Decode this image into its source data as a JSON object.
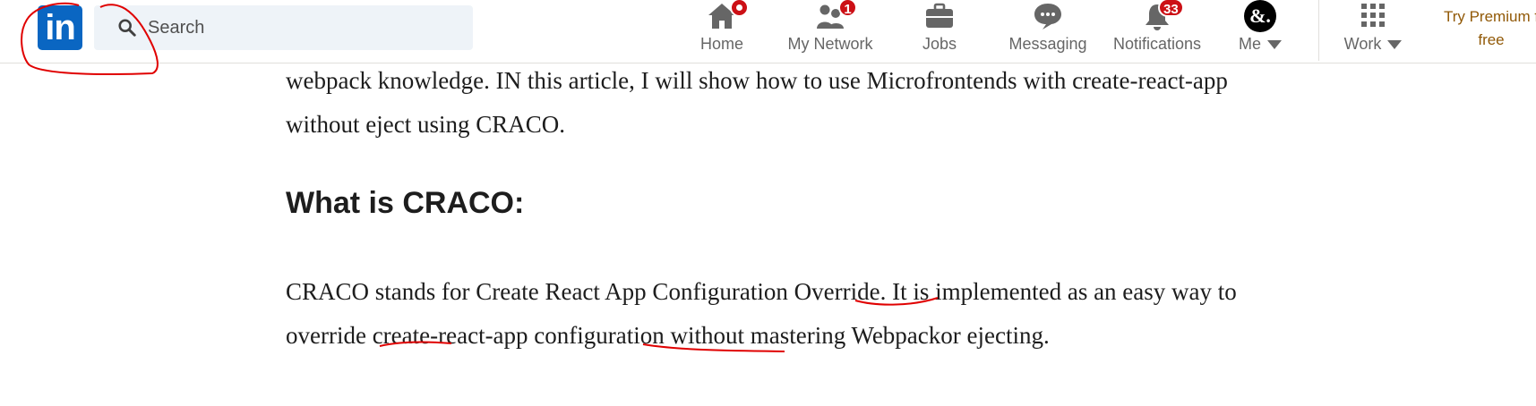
{
  "nav": {
    "logo_text": "in",
    "search": {
      "placeholder": "Search",
      "value": ""
    },
    "items": [
      {
        "id": "home",
        "label": "Home",
        "icon": "home-icon",
        "badge": ""
      },
      {
        "id": "network",
        "label": "My Network",
        "icon": "people-icon",
        "badge": "1"
      },
      {
        "id": "jobs",
        "label": "Jobs",
        "icon": "briefcase-icon",
        "badge": ""
      },
      {
        "id": "messaging",
        "label": "Messaging",
        "icon": "chat-icon",
        "badge": ""
      },
      {
        "id": "notifications",
        "label": "Notifications",
        "icon": "bell-icon",
        "badge": "33"
      },
      {
        "id": "me",
        "label": "Me",
        "icon": "avatar-icon",
        "badge": ""
      },
      {
        "id": "work",
        "label": "Work",
        "icon": "grid-icon",
        "badge": ""
      }
    ],
    "avatar_text": "&.",
    "premium": {
      "line1": "Try Premium f",
      "line2": "free"
    }
  },
  "article": {
    "intro": "webpack knowledge. IN this article, I will show how to use Microfrontends with create-react-app without eject using CRACO.",
    "heading": "What is CRACO:",
    "body": {
      "t1": "CRACO stands for Create React App Configuration ",
      "w1": "Override",
      "t2": ". It is implemented as an easy way to ",
      "w2": "override",
      "t3": " create-react-app ",
      "w3": "configuration",
      "t4": " without mastering Webpackor ejecting."
    }
  },
  "colors": {
    "brand": "#0a66c2",
    "badge": "#cc1016",
    "premium": "#915907",
    "annotation": "#e00000"
  }
}
